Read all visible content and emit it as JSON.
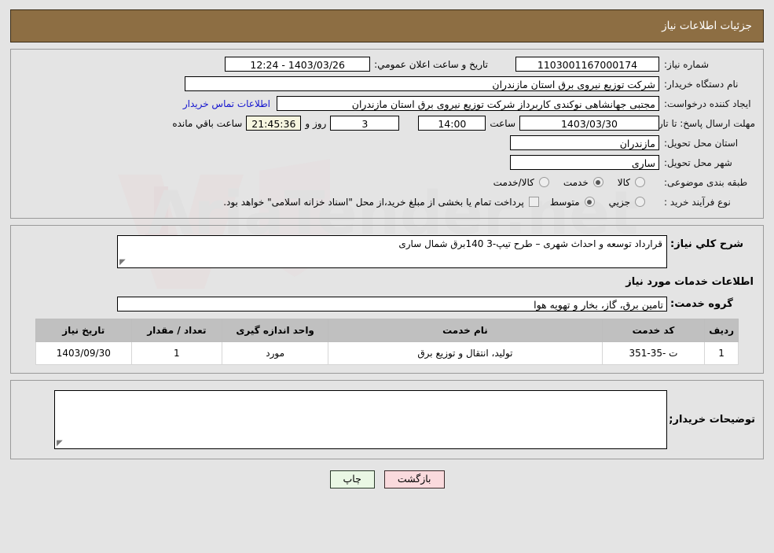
{
  "header": {
    "title": "جزئیات اطلاعات نیاز"
  },
  "form": {
    "need_number_label": "شماره نیاز:",
    "need_number_value": "1103001167000174",
    "announce_label": "تاریخ و ساعت اعلان عمومي:",
    "announce_value": "1403/03/26 - 12:24",
    "buyer_org_label": "نام دستگاه خریدار:",
    "buyer_org_value": "شرکت توزیع نیروی برق استان مازندران",
    "creator_label": "ایجاد کننده درخواست:",
    "creator_value": "مجتبی جهانشاهی نوکندی کاربرداز شرکت توزیع نیروی برق استان مازندران",
    "contact_link": "اطلاعات تماس خریدار",
    "deadline_label": "مهلت ارسال پاسخ: تا تاریخ:",
    "deadline_date": "1403/03/30",
    "hour_label": "ساعت",
    "hour_value": "14:00",
    "days_value": "3",
    "days_label": "روز و",
    "countdown_value": "21:45:36",
    "countdown_label": "ساعت باقي مانده",
    "province_label": "استان محل تحویل:",
    "province_value": "مازندران",
    "city_label": "شهر محل تحویل:",
    "city_value": "ساری",
    "category_label": "طبقه بندی موضوعی:",
    "category_options": [
      {
        "label": "کالا",
        "selected": false
      },
      {
        "label": "خدمت",
        "selected": true
      },
      {
        "label": "کالا/خدمت",
        "selected": false
      }
    ],
    "process_label": "نوع فرآیند خرید :",
    "process_options": [
      {
        "label": "جزیي",
        "selected": false
      },
      {
        "label": "متوسط",
        "selected": true
      }
    ],
    "treasury_checkbox_label": "پرداخت تمام یا بخشی از مبلغ خرید،از محل \"اسناد خزانه اسلامی\" خواهد بود.",
    "treasury_checked": false
  },
  "middle": {
    "general_desc_label": "شرح کلي نیاز:",
    "general_desc_value": "قرارداد توسعه و احداث شهری – طرح تیپ-3 140برق شمال ساری",
    "services_section_title": "اطلاعات خدمات مورد نیاز",
    "service_group_label": "گروه خدمت:",
    "service_group_value": "تامین برق، گاز، بخار و تهویه هوا"
  },
  "table": {
    "columns": [
      "ردیف",
      "کد خدمت",
      "نام خدمت",
      "واحد اندازه گیری",
      "تعداد / مقدار",
      "تاریخ نیاز"
    ],
    "rows": [
      {
        "row_no": "1",
        "service_code": "ت -35-351",
        "service_name": "تولید، انتقال و توزیع برق",
        "unit": "مورد",
        "quantity": "1",
        "need_date": "1403/09/30"
      }
    ]
  },
  "buyer_notes": {
    "label": "توضیحات خریدار;",
    "value": ""
  },
  "buttons": {
    "print": "چاپ",
    "back": "بازگشت"
  },
  "watermark": {
    "text": "AriaTender.net"
  },
  "colors": {
    "header_bg": "#8d6e43",
    "page_bg": "#e4e4e4",
    "link": "#1414cf",
    "table_header_bg": "#c0c0c0",
    "countdown_bg": "#f7f6e0",
    "back_btn_bg": "#fadadd",
    "print_btn_bg": "#e9f7e4"
  }
}
